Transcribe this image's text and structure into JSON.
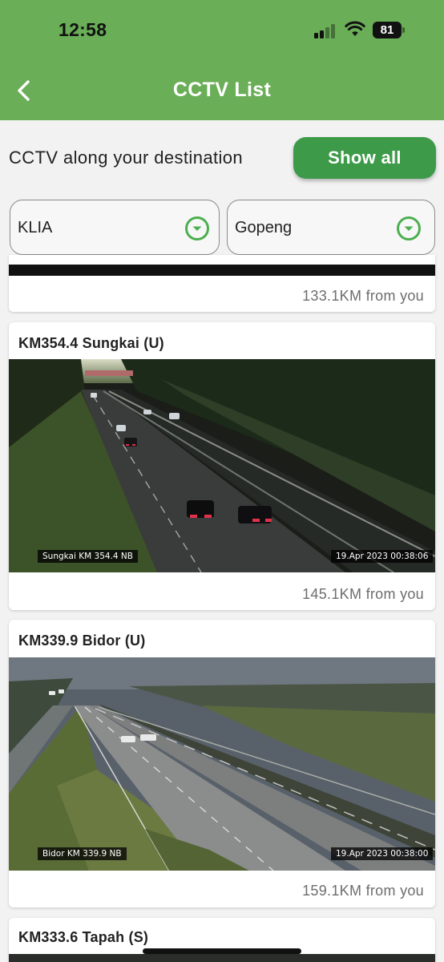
{
  "status": {
    "time": "12:58",
    "battery": "81"
  },
  "header": {
    "title": "CCTV List"
  },
  "filter": {
    "label": "CCTV along your destination",
    "show_all": "Show all",
    "from": "KLIA",
    "to": "Gopeng"
  },
  "cameras": [
    {
      "distance": "133.1KM from you"
    },
    {
      "title": "KM354.4 Sungkai (U)",
      "overlay": "Sungkai KM 354.4 NB",
      "timestamp": "19.Apr 2023   00:38:06",
      "distance": "145.1KM from you"
    },
    {
      "title": "KM339.9 Bidor (U)",
      "overlay": "Bidor KM 339.9 NB",
      "timestamp": "19.Apr 2023   00:38:00",
      "distance": "159.1KM from you"
    },
    {
      "title": "KM333.6 Tapah (S)"
    }
  ],
  "colors": {
    "header": "#6aae57",
    "button": "#3c9a48",
    "accent": "#4caf50"
  },
  "icons": {
    "back": "chevron-left-icon",
    "dropdown": "chevron-down-circle-icon",
    "signal": "cellular-signal-icon",
    "wifi": "wifi-icon",
    "battery": "battery-icon"
  }
}
